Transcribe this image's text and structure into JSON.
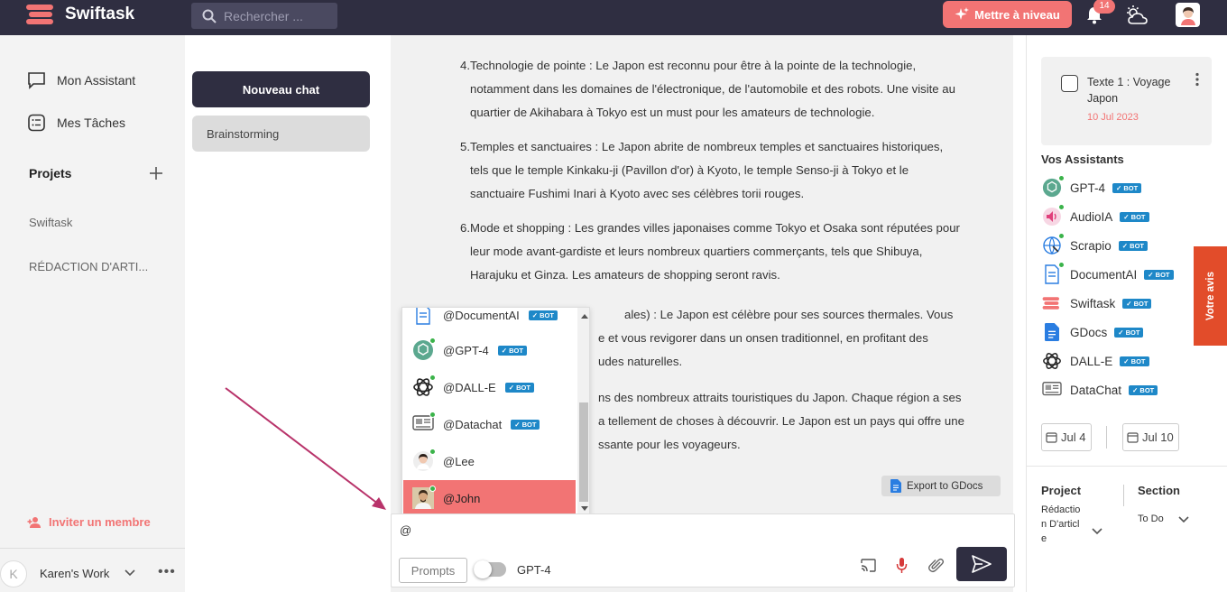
{
  "app": {
    "name": "Swiftask"
  },
  "header": {
    "search_placeholder": "Rechercher ...",
    "upgrade_label": "Mettre à niveau",
    "notification_count": "14"
  },
  "sidebar": {
    "items": [
      {
        "label": "Mon Assistant",
        "icon": "chat-bubble-icon"
      },
      {
        "label": "Mes Tâches",
        "icon": "task-list-icon"
      }
    ],
    "projects_label": "Projets",
    "projects": [
      "Swiftask",
      "RÉDACTION D'ARTI..."
    ],
    "invite_label": "Inviter un membre",
    "workspace_initial": "K",
    "workspace_name": "Karen's Work"
  },
  "chatlist": {
    "new_chat_label": "Nouveau chat",
    "chats": [
      "Brainstorming"
    ]
  },
  "message": {
    "items": [
      {
        "num": "4.",
        "text": "Technologie de pointe : Le Japon est reconnu pour être à la pointe de la technologie, notamment dans les domaines de l'électronique, de l'automobile et des robots. Une visite au quartier de Akihabara à Tokyo est un must pour les amateurs de technologie."
      },
      {
        "num": "5.",
        "text": "Temples et sanctuaires : Le Japon abrite de nombreux temples et sanctuaires historiques, tels que le temple Kinkaku-ji (Pavillon d'or) à Kyoto, le temple Senso-ji à Tokyo et le sanctuaire Fushimi Inari à Kyoto avec ses célèbres torii rouges."
      },
      {
        "num": "6.",
        "text": "Mode et shopping : Les grandes villes japonaises comme Tokyo et Osaka sont réputées pour leur mode avant-gardiste et leurs nombreux quartiers commerçants, tels que Shibuya, Harajuku et Ginza. Les amateurs de shopping seront ravis."
      }
    ],
    "partial_lines": [
      "ales) : Le Japon est célèbre pour ses sources thermales. Vous",
      "e et vous revigorer dans un onsen traditionnel, en profitant des",
      "udes naturelles.",
      "ns des nombreux attraits touristiques du Japon. Chaque région a ses",
      "a tellement de choses à découvrir. Le Japon est un pays qui offre une",
      "ssante pour les voyageurs."
    ],
    "export_label": "Export to GDocs"
  },
  "mention_popup": {
    "bot_label": "BOT",
    "items": [
      {
        "label": "@DocumentAI",
        "bot": true,
        "icon": "document-ai-icon"
      },
      {
        "label": "@GPT-4",
        "bot": true,
        "icon": "gpt-icon"
      },
      {
        "label": "@DALL-E",
        "bot": true,
        "icon": "openai-icon"
      },
      {
        "label": "@Datachat",
        "bot": true,
        "icon": "datachat-icon"
      },
      {
        "label": "@Lee",
        "bot": false,
        "icon": "user-avatar-icon"
      },
      {
        "label": "@John",
        "bot": false,
        "icon": "user-avatar-icon",
        "selected": true
      }
    ]
  },
  "composer": {
    "value": "@",
    "prompts_label": "Prompts",
    "model_label": "GPT-4"
  },
  "rightpanel": {
    "doc_title": "Texte 1 : Voyage Japon",
    "doc_date": "10 Jul 2023",
    "assistants_label": "Vos Assistants",
    "assistants": [
      {
        "name": "GPT-4",
        "icon": "gpt-icon"
      },
      {
        "name": "AudioIA",
        "icon": "audio-icon"
      },
      {
        "name": "Scrapio",
        "icon": "scrapio-icon"
      },
      {
        "name": "DocumentAI",
        "icon": "document-ai-icon"
      },
      {
        "name": "Swiftask",
        "icon": "swiftask-icon"
      },
      {
        "name": "GDocs",
        "icon": "gdocs-icon"
      },
      {
        "name": "DALL-E",
        "icon": "openai-icon"
      },
      {
        "name": "DataChat",
        "icon": "datachat-icon"
      }
    ],
    "date_start": "Jul 4",
    "date_end": "Jul 10",
    "project_label": "Project",
    "project_value": "Rédaction D'article",
    "section_label": "Section",
    "section_value": "To Do"
  },
  "feedback_label": "Votre avis",
  "colors": {
    "accent": "#f27474",
    "dark": "#2f2e41",
    "bot": "#1e88c8",
    "online": "#3bb34a"
  }
}
